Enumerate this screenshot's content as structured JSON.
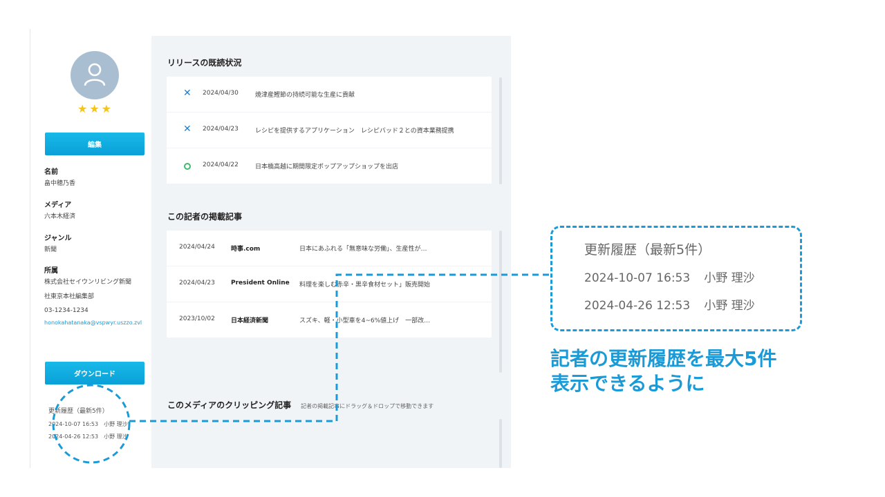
{
  "sidebar": {
    "rating": "★★★",
    "edit_label": "編集",
    "fields": {
      "name_label": "名前",
      "name_value": "畠中穂乃香",
      "media_label": "メディア",
      "media_value": "六本木経済",
      "genre_label": "ジャンル",
      "genre_value": "新聞",
      "affiliation_label": "所属",
      "affiliation_value1": "株式会社セイウンリビング新聞",
      "affiliation_value2": "社東京本社編集部",
      "phone": "03-1234-1234",
      "email": "honokahatanaka@vspwyr.uszzo.zvl"
    },
    "download_label": "ダウンロード",
    "history": {
      "title": "更新履歴（最新5件）",
      "rows": [
        {
          "datetime": "2024-10-07 16:53",
          "user": "小野 理沙"
        },
        {
          "datetime": "2024-04-26 12:53",
          "user": "小野 理沙"
        }
      ]
    }
  },
  "main": {
    "read_status": {
      "title": "リリースの既読状況",
      "rows": [
        {
          "status": "unread",
          "icon": "x-icon",
          "date": "2024/04/30",
          "title": "焼津産鰹節の持続可能な生産に貢献"
        },
        {
          "status": "unread",
          "icon": "x-icon",
          "date": "2024/04/23",
          "title": "レシピを提供するアプリケーション　レシピバッド２との資本業務提携"
        },
        {
          "status": "read",
          "icon": "circle-icon",
          "date": "2024/04/22",
          "title": "日本橋高越に期間限定ポップアップショップを出店"
        }
      ]
    },
    "articles": {
      "title": "この記者の掲載記事",
      "rows": [
        {
          "date": "2024/04/24",
          "media": "時事.com",
          "headline": "日本にあふれる「無意味な労働」、生産性が…"
        },
        {
          "date": "2024/04/23",
          "media": "President Online",
          "headline": "料理を楽しむ赤辛・黒辛食材セット」販売開始"
        },
        {
          "date": "2023/10/02",
          "media": "日本経済新聞",
          "headline": "スズキ、軽・小型車を4~6%値上げ　一部改…"
        }
      ]
    },
    "clipping": {
      "title": "このメディアのクリッピング記事",
      "subtitle": "記者の掲載記事にドラッグ＆ドロップで移動できます"
    }
  },
  "callout": {
    "title": "更新履歴（最新5件）",
    "rows": [
      {
        "datetime": "2024-10-07 16:53",
        "user": "小野 理沙"
      },
      {
        "datetime": "2024-04-26 12:53",
        "user": "小野 理沙"
      }
    ]
  },
  "annotation": {
    "line1": "記者の更新履歴を最大5件",
    "line2": "表示できるように"
  },
  "colors": {
    "accent": "#1a9ad6",
    "button": "#0fb0e4",
    "star": "#f6c31a",
    "unread": "#1a7fd0",
    "read": "#3dbb6a"
  }
}
